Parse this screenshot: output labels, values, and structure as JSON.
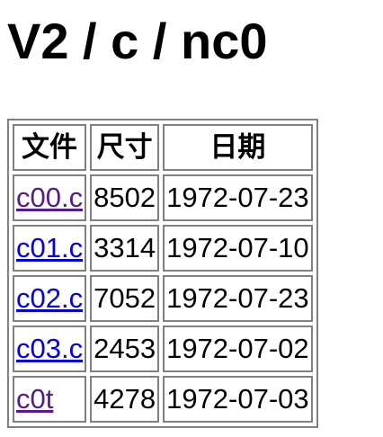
{
  "page": {
    "title": "V2 / c / nc0"
  },
  "colors": {
    "link": "#0000ee",
    "visited_link": "#551a8b",
    "table_border": "#808080"
  },
  "table": {
    "headers": [
      "文件",
      "尺寸",
      "日期"
    ],
    "rows": [
      {
        "name": "c00.c",
        "size": "8502",
        "date": "1972-07-23",
        "visited": true
      },
      {
        "name": "c01.c",
        "size": "3314",
        "date": "1972-07-10",
        "visited": false
      },
      {
        "name": "c02.c",
        "size": "7052",
        "date": "1972-07-23",
        "visited": false
      },
      {
        "name": "c03.c",
        "size": "2453",
        "date": "1972-07-02",
        "visited": false
      },
      {
        "name": "c0t",
        "size": "4278",
        "date": "1972-07-03",
        "visited": true
      }
    ]
  }
}
